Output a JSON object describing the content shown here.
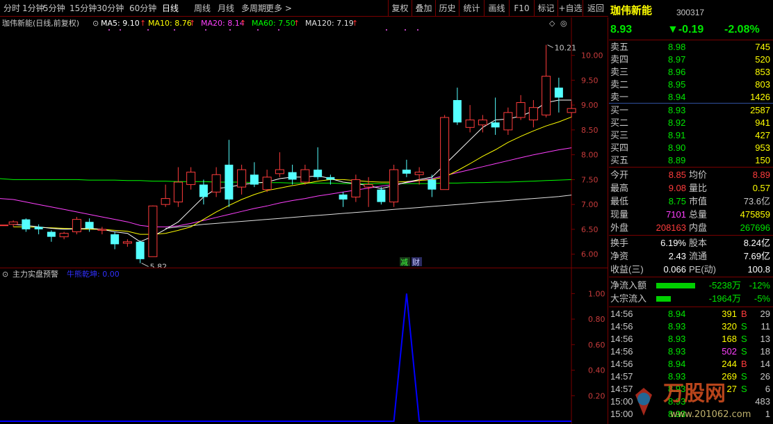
{
  "toolbar": {
    "tabs": [
      "分时",
      "1分钟",
      "5分钟",
      "15分钟",
      "30分钟",
      "60分钟",
      "日线",
      "周线",
      "月线",
      "多周期",
      "更多 >"
    ],
    "active_tab": "日线",
    "buttons": [
      "复权",
      "叠加",
      "历史",
      "统计",
      "画线",
      "F10",
      "标记",
      "+自选",
      "返回"
    ]
  },
  "chart_header": {
    "title": "珈伟新能(日线,前复权)",
    "ma": [
      {
        "label": "MA5: 9.10",
        "color": "#ffffff"
      },
      {
        "label": "MA10: 8.76",
        "color": "#ffff00"
      },
      {
        "label": "MA20: 8.14",
        "color": "#ff40ff"
      },
      {
        "label": "MA60: 7.50",
        "color": "#00ff00"
      },
      {
        "label": "MA120: 7.19",
        "color": "#e0e0e0"
      }
    ],
    "arrow": "↑"
  },
  "price_axis": [
    "10.00",
    "9.50",
    "9.00",
    "8.50",
    "8.00",
    "7.50",
    "7.00",
    "6.50",
    "6.00"
  ],
  "annotations": {
    "high": "10.21",
    "low": "5.82",
    "badge1": "减",
    "badge2": "财"
  },
  "chart_data": [
    {
      "type": "candlestick",
      "title": "珈伟新能(日线,前复权)",
      "ylim": [
        5.8,
        10.4
      ],
      "candles": [
        {
          "o": 6.6,
          "c": 6.65,
          "h": 6.68,
          "l": 6.55
        },
        {
          "o": 6.7,
          "c": 6.5,
          "h": 6.72,
          "l": 6.45
        },
        {
          "o": 6.55,
          "c": 6.5,
          "h": 6.6,
          "l": 6.4
        },
        {
          "o": 6.45,
          "c": 6.35,
          "h": 6.48,
          "l": 6.25
        },
        {
          "o": 6.35,
          "c": 6.42,
          "h": 6.45,
          "l": 6.3
        },
        {
          "o": 6.45,
          "c": 6.7,
          "h": 6.75,
          "l": 6.4
        },
        {
          "o": 6.65,
          "c": 6.52,
          "h": 6.72,
          "l": 6.45
        },
        {
          "o": 6.48,
          "c": 6.5,
          "h": 6.55,
          "l": 6.4
        },
        {
          "o": 6.4,
          "c": 6.2,
          "h": 6.45,
          "l": 6.1
        },
        {
          "o": 6.22,
          "c": 6.25,
          "h": 6.3,
          "l": 6.15
        },
        {
          "o": 6.25,
          "c": 5.9,
          "h": 6.28,
          "l": 5.82
        },
        {
          "o": 5.95,
          "c": 6.97,
          "h": 6.98,
          "l": 5.95
        },
        {
          "o": 7.0,
          "c": 7.12,
          "h": 7.4,
          "l": 6.95
        },
        {
          "o": 7.05,
          "c": 7.45,
          "h": 7.75,
          "l": 6.95
        },
        {
          "o": 7.4,
          "c": 7.65,
          "h": 7.75,
          "l": 7.3
        },
        {
          "o": 7.4,
          "c": 7.15,
          "h": 7.5,
          "l": 7.0
        },
        {
          "o": 7.25,
          "c": 7.6,
          "h": 7.75,
          "l": 7.15
        },
        {
          "o": 7.8,
          "c": 7.1,
          "h": 8.3,
          "l": 6.95
        },
        {
          "o": 7.35,
          "c": 7.7,
          "h": 7.8,
          "l": 7.2
        },
        {
          "o": 7.6,
          "c": 7.4,
          "h": 7.85,
          "l": 7.35
        },
        {
          "o": 7.3,
          "c": 7.55,
          "h": 7.7,
          "l": 7.25
        },
        {
          "o": 7.62,
          "c": 7.7,
          "h": 8.05,
          "l": 7.55
        },
        {
          "o": 7.65,
          "c": 7.5,
          "h": 7.8,
          "l": 7.4
        },
        {
          "o": 7.45,
          "c": 7.7,
          "h": 7.8,
          "l": 7.4
        },
        {
          "o": 7.7,
          "c": 7.55,
          "h": 8.15,
          "l": 7.5
        },
        {
          "o": 7.55,
          "c": 7.5,
          "h": 7.6,
          "l": 7.4
        },
        {
          "o": 7.2,
          "c": 7.1,
          "h": 7.25,
          "l": 6.95
        },
        {
          "o": 7.15,
          "c": 7.5,
          "h": 7.6,
          "l": 7.05
        },
        {
          "o": 7.35,
          "c": 7.4,
          "h": 7.55,
          "l": 6.95
        },
        {
          "o": 7.3,
          "c": 7.05,
          "h": 7.35,
          "l": 7.0
        },
        {
          "o": 7.05,
          "c": 7.7,
          "h": 7.8,
          "l": 6.95
        },
        {
          "o": 7.7,
          "c": 7.62,
          "h": 7.9,
          "l": 7.55
        },
        {
          "o": 7.6,
          "c": 7.65,
          "h": 7.75,
          "l": 7.4
        },
        {
          "o": 7.5,
          "c": 7.3,
          "h": 7.6,
          "l": 7.15
        },
        {
          "o": 7.3,
          "c": 8.75,
          "h": 8.8,
          "l": 7.3
        },
        {
          "o": 9.1,
          "c": 8.65,
          "h": 9.35,
          "l": 8.6
        },
        {
          "o": 8.55,
          "c": 8.7,
          "h": 9.0,
          "l": 8.45
        },
        {
          "o": 8.6,
          "c": 8.7,
          "h": 8.8,
          "l": 8.45
        },
        {
          "o": 8.65,
          "c": 8.55,
          "h": 9.15,
          "l": 8.4
        },
        {
          "o": 8.5,
          "c": 8.85,
          "h": 8.95,
          "l": 8.4
        },
        {
          "o": 8.75,
          "c": 9.05,
          "h": 9.2,
          "l": 8.7
        },
        {
          "o": 8.7,
          "c": 8.95,
          "h": 9.1,
          "l": 8.55
        },
        {
          "o": 8.8,
          "c": 9.58,
          "h": 10.21,
          "l": 8.75
        },
        {
          "o": 9.35,
          "c": 9.15,
          "h": 9.55,
          "l": 8.85
        },
        {
          "o": 8.85,
          "c": 8.93,
          "h": 9.08,
          "l": 8.75
        }
      ],
      "ma_lines": [
        {
          "name": "MA5",
          "color": "#ffffff",
          "values": [
            6.6,
            6.58,
            6.55,
            6.52,
            6.5,
            6.51,
            6.52,
            6.5,
            6.45,
            6.42,
            6.25,
            6.36,
            6.5,
            6.65,
            6.9,
            7.15,
            7.32,
            7.35,
            7.4,
            7.43,
            7.45,
            7.52,
            7.55,
            7.55,
            7.58,
            7.52,
            7.45,
            7.42,
            7.38,
            7.32,
            7.38,
            7.45,
            7.5,
            7.55,
            7.8,
            8.05,
            8.3,
            8.55,
            8.7,
            8.72,
            8.78,
            8.88,
            9.05,
            9.1,
            9.1
          ]
        },
        {
          "name": "MA10",
          "color": "#ffff00",
          "values": [
            6.55,
            6.55,
            6.54,
            6.53,
            6.52,
            6.51,
            6.5,
            6.5,
            6.48,
            6.46,
            6.4,
            6.4,
            6.42,
            6.48,
            6.55,
            6.7,
            6.85,
            6.98,
            7.1,
            7.2,
            7.28,
            7.33,
            7.38,
            7.42,
            7.47,
            7.5,
            7.5,
            7.48,
            7.46,
            7.45,
            7.45,
            7.46,
            7.48,
            7.5,
            7.55,
            7.68,
            7.82,
            7.97,
            8.1,
            8.25,
            8.37,
            8.48,
            8.58,
            8.66,
            8.76
          ]
        },
        {
          "name": "MA20",
          "color": "#ff40ff",
          "values": [
            7.1,
            7.05,
            7.0,
            6.95,
            6.9,
            6.85,
            6.8,
            6.75,
            6.7,
            6.65,
            6.58,
            6.55,
            6.55,
            6.57,
            6.62,
            6.68,
            6.74,
            6.8,
            6.86,
            6.92,
            6.97,
            7.03,
            7.08,
            7.12,
            7.17,
            7.21,
            7.25,
            7.29,
            7.33,
            7.37,
            7.4,
            7.44,
            7.48,
            7.52,
            7.58,
            7.64,
            7.7,
            7.76,
            7.82,
            7.88,
            7.94,
            8.0,
            8.05,
            8.1,
            8.14
          ]
        },
        {
          "name": "MA60",
          "color": "#00ff00",
          "values": [
            7.5,
            7.5,
            7.5,
            7.5,
            7.5,
            7.5,
            7.49,
            7.49,
            7.49,
            7.48,
            7.48,
            7.47,
            7.47,
            7.46,
            7.46,
            7.46,
            7.45,
            7.45,
            7.45,
            7.44,
            7.44,
            7.44,
            7.43,
            7.43,
            7.43,
            7.43,
            7.42,
            7.42,
            7.42,
            7.42,
            7.42,
            7.42,
            7.42,
            7.42,
            7.43,
            7.43,
            7.44,
            7.44,
            7.45,
            7.45,
            7.46,
            7.47,
            7.48,
            7.49,
            7.5
          ]
        },
        {
          "name": "MA120",
          "color": "#e0e0e0",
          "values": [
            null,
            null,
            null,
            null,
            null,
            null,
            null,
            null,
            null,
            null,
            null,
            null,
            6.52,
            6.55,
            6.57,
            6.6,
            6.62,
            6.64,
            6.66,
            6.68,
            6.7,
            6.72,
            6.74,
            6.76,
            6.78,
            6.8,
            6.82,
            6.84,
            6.86,
            6.88,
            6.9,
            6.92,
            6.94,
            6.96,
            6.98,
            7.0,
            7.02,
            7.04,
            7.06,
            7.08,
            7.1,
            7.12,
            7.14,
            7.16,
            7.19
          ]
        }
      ]
    },
    {
      "type": "line",
      "title": "主力实盘预警",
      "series": [
        {
          "name": "牛熊乾坤",
          "color": "#0000ff",
          "values": [
            0,
            0,
            0,
            0,
            0,
            0,
            0,
            0,
            0,
            0,
            0,
            0,
            0,
            0,
            0,
            0,
            0,
            0,
            0,
            0,
            0,
            0,
            0,
            0,
            0,
            0,
            0,
            0,
            0,
            0,
            0,
            1,
            0,
            0,
            0,
            0,
            0,
            0,
            0,
            0,
            0,
            0,
            0,
            0,
            0
          ]
        }
      ],
      "ylim": [
        0,
        1.1
      ],
      "ytick_labels": [
        "1.00",
        "0.80",
        "0.60",
        "0.40",
        "0.20"
      ]
    }
  ],
  "indicator": {
    "title": "主力实盘预警",
    "series_label": "牛熊乾坤: 0.00"
  },
  "stock": {
    "name": "珈伟新能",
    "code": "300317",
    "price": "8.93",
    "change": "▼-0.19",
    "pct": "-2.08%"
  },
  "orderbook": {
    "asks": [
      {
        "label": "卖五",
        "price": "8.98",
        "vol": "745"
      },
      {
        "label": "卖四",
        "price": "8.97",
        "vol": "520"
      },
      {
        "label": "卖三",
        "price": "8.96",
        "vol": "853"
      },
      {
        "label": "卖二",
        "price": "8.95",
        "vol": "803"
      },
      {
        "label": "卖一",
        "price": "8.94",
        "vol": "1426"
      }
    ],
    "bids": [
      {
        "label": "买一",
        "price": "8.93",
        "vol": "2587"
      },
      {
        "label": "买二",
        "price": "8.92",
        "vol": "941"
      },
      {
        "label": "买三",
        "price": "8.91",
        "vol": "427"
      },
      {
        "label": "买四",
        "price": "8.90",
        "vol": "953"
      },
      {
        "label": "买五",
        "price": "8.89",
        "vol": "150"
      }
    ]
  },
  "stats": [
    {
      "k1": "今开",
      "v1": "8.85",
      "k2": "均价",
      "v2": "8.89",
      "c1": "red",
      "c2": "red"
    },
    {
      "k1": "最高",
      "v1": "9.08",
      "k2": "量比",
      "v2": "0.57",
      "c1": "red",
      "c2": "yellow"
    },
    {
      "k1": "最低",
      "v1": "8.75",
      "k2": "市值",
      "v2": "73.6亿",
      "c1": "green",
      "c2": "grey"
    },
    {
      "k1": "现量",
      "v1": "7101",
      "k2": "总量",
      "v2": "475859",
      "c1": "purple",
      "c2": "yellow"
    },
    {
      "k1": "外盘",
      "v1": "208163",
      "k2": "内盘",
      "v2": "267696",
      "c1": "red",
      "c2": "green"
    }
  ],
  "fundamentals": [
    {
      "k1": "换手",
      "v1": "6.19%",
      "k2": "股本",
      "v2": "8.24亿"
    },
    {
      "k1": "净资",
      "v1": "2.43",
      "k2": "流通",
      "v2": "7.69亿"
    },
    {
      "k1": "收益(三)",
      "v1": "0.066",
      "k2": "PE(动)",
      "v2": "100.8"
    }
  ],
  "flows": [
    {
      "label": "净流入额",
      "value": "-5238万",
      "pct": "-12%",
      "fill": 0.8
    },
    {
      "label": "大宗流入",
      "value": "-1964万",
      "pct": "-5%",
      "fill": 0.3
    }
  ],
  "ticks": [
    {
      "time": "14:56",
      "price": "8.94",
      "vol": "391",
      "side": "B",
      "n": "29"
    },
    {
      "time": "14:56",
      "price": "8.93",
      "vol": "320",
      "side": "S",
      "n": "11"
    },
    {
      "time": "14:56",
      "price": "8.93",
      "vol": "168",
      "side": "S",
      "n": "13"
    },
    {
      "time": "14:56",
      "price": "8.93",
      "vol": "502",
      "side": "S",
      "n": "18"
    },
    {
      "time": "14:56",
      "price": "8.94",
      "vol": "244",
      "side": "B",
      "n": "14"
    },
    {
      "time": "14:57",
      "price": "8.93",
      "vol": "269",
      "side": "S",
      "n": "26"
    },
    {
      "time": "14:57",
      "price": "8.93",
      "vol": "27",
      "side": "S",
      "n": "6"
    },
    {
      "time": "15:00",
      "price": "8.93",
      "vol": "",
      "side": "",
      "n": "483"
    },
    {
      "time": "15:00",
      "price": "8.93",
      "vol": "",
      "side": "",
      "n": "1"
    }
  ],
  "watermark": {
    "text": "万股网",
    "url": "www.201062.com"
  }
}
